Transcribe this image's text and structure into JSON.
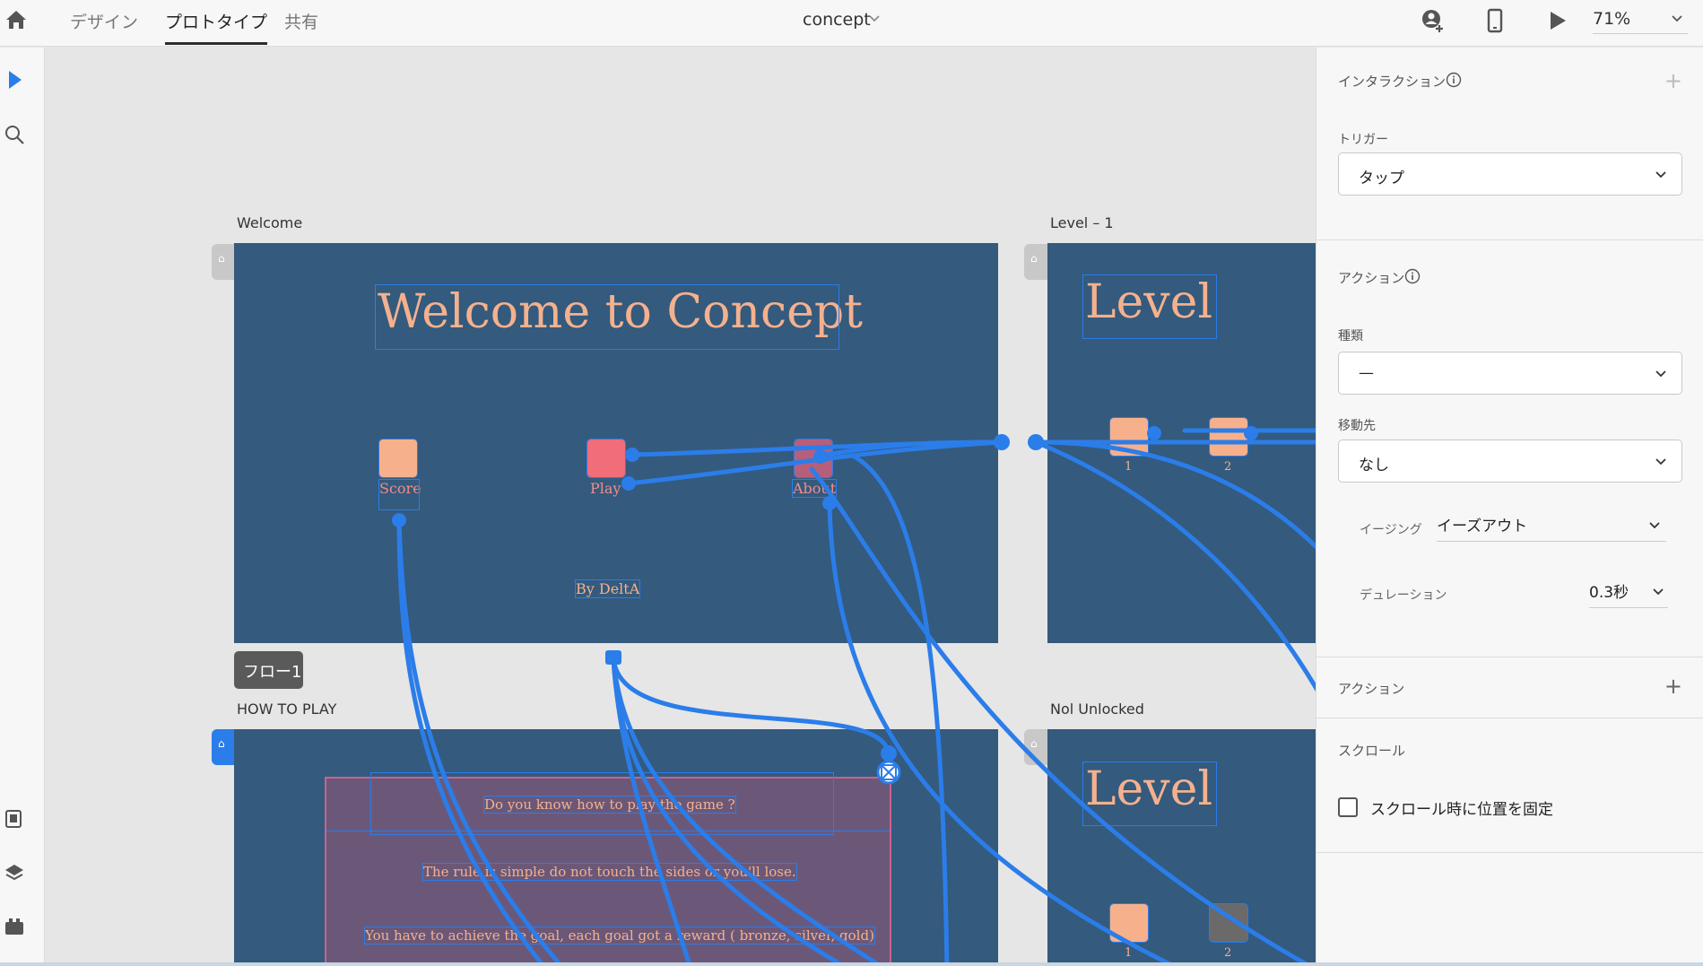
{
  "topbar": {
    "tabs": [
      {
        "label": "デザイン",
        "active": false
      },
      {
        "label": "プロトタイプ",
        "active": true
      },
      {
        "label": "共有",
        "active": false
      }
    ],
    "document_title": "concept",
    "zoom": "71%",
    "icons": [
      "home-icon",
      "share-user-icon",
      "device-preview-icon",
      "play-icon",
      "chevron-down-icon"
    ]
  },
  "left_toolbar": {
    "tools": [
      "select-arrow-icon",
      "zoom-search-icon",
      "assets-icon",
      "layers-icon",
      "plugins-icon"
    ]
  },
  "canvas": {
    "artboards": {
      "welcome": {
        "label": "Welcome",
        "title": "Welcome to Concept",
        "buttons": [
          "Score",
          "Play",
          "About"
        ],
        "credit": "By DeltA"
      },
      "level1": {
        "label": "Level – 1",
        "title": "Level",
        "buttons": [
          "1",
          "2"
        ]
      },
      "how_to_play": {
        "label": "HOW TO PLAY",
        "lines": [
          "Do you know how to play the game ?",
          "The rule is simple do not touch the sides or you'll lose.",
          "You have to achieve the goal, each goal got a reward ( bronze, silver, gold)"
        ]
      },
      "not_unlocked": {
        "label": "Nol Unlocked",
        "title": "Level",
        "buttons": [
          "1",
          "2"
        ]
      }
    },
    "flow_badge": "フロー1"
  },
  "panel": {
    "interaction": {
      "heading": "インタラクション"
    },
    "trigger": {
      "label": "トリガー",
      "value": "タップ"
    },
    "action": {
      "heading": "アクション",
      "type_label": "種類",
      "type_value": "—",
      "destination_label": "移動先",
      "destination_value": "なし",
      "easing_label": "イージング",
      "easing_value": "イーズアウト",
      "duration_label": "デュレーション",
      "duration_value": "0.3秒"
    },
    "add_action": {
      "heading": "アクション"
    },
    "scroll": {
      "heading": "スクロール",
      "checkbox_label": "スクロール時に位置を固定",
      "checked": false
    }
  },
  "colors": {
    "artboard_bg": "#345a7d",
    "wire": "#2b7de9",
    "accent_text": "#f4b18e",
    "button_peach": "#f7b08c",
    "button_red": "#f06d79",
    "button_muted": "#b75e7a",
    "modal_bg": "#6b5878"
  }
}
